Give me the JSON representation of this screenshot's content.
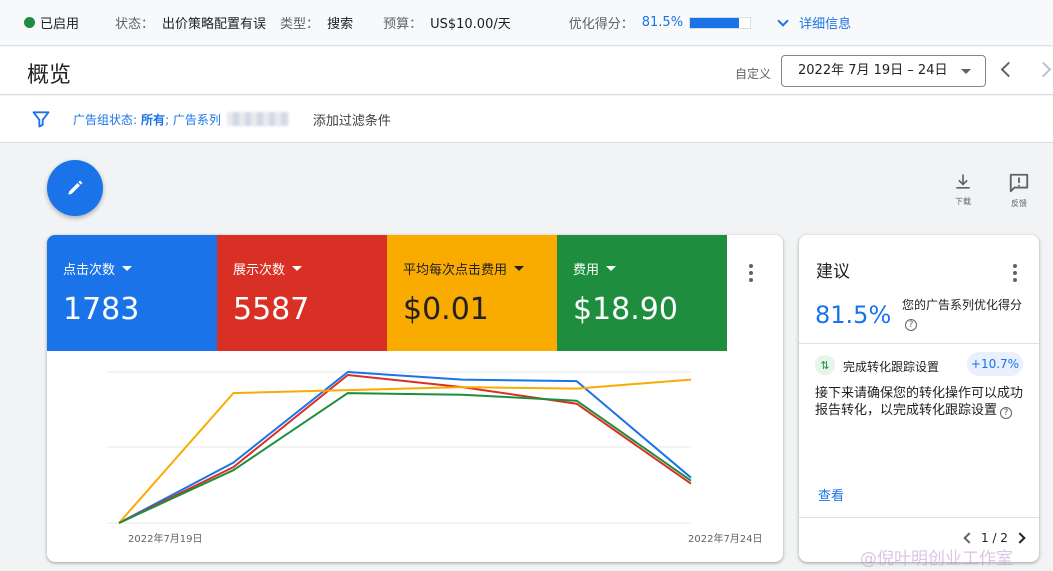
{
  "statusbar": {
    "enabled_label": "已启用",
    "status_label": "状态：",
    "status_value": "出价策略配置有误",
    "type_label": "类型：",
    "type_value": "搜索",
    "budget_label": "预算：",
    "budget_value": "US$10.00/天",
    "score_label": "优化得分：",
    "score_value": "81.5%",
    "score_fraction": 0.815,
    "details_label": "详细信息"
  },
  "header": {
    "title": "概览",
    "custom_label": "自定义",
    "date_range": "2022年 7月 19日 – 24日"
  },
  "filters": {
    "chip_prefix": "广告组状态:",
    "chip_value": "所有",
    "chip_suffix": "; 广告系列",
    "add_filter": "添加过滤条件"
  },
  "tools": {
    "download_label": "下载",
    "feedback_label": "反馈"
  },
  "metrics": [
    {
      "name": "点击次数",
      "value": "1783",
      "color": "#1a73e8"
    },
    {
      "name": "展示次数",
      "value": "5587",
      "color": "#d93025"
    },
    {
      "name": "平均每次点击费用",
      "value": "$0.01",
      "color": "#f9ab00"
    },
    {
      "name": "费用",
      "value": "$18.90",
      "color": "#1e8e3e"
    }
  ],
  "chart_data": {
    "type": "line",
    "x_start_label": "2022年7月19日",
    "x_end_label": "2022年7月24日",
    "grid": true,
    "series": [
      {
        "name": "点击次数",
        "color": "#1a73e8",
        "values": [
          0.0,
          0.4,
          1.0,
          0.95,
          0.94,
          0.3
        ]
      },
      {
        "name": "展示次数",
        "color": "#d93025",
        "values": [
          0.0,
          0.37,
          0.98,
          0.9,
          0.79,
          0.26
        ]
      },
      {
        "name": "平均每次点击费用",
        "color": "#f9ab00",
        "values": [
          0.0,
          0.86,
          0.88,
          0.9,
          0.89,
          0.95
        ]
      },
      {
        "name": "费用",
        "color": "#1e8e3e",
        "values": [
          0.0,
          0.35,
          0.86,
          0.85,
          0.81,
          0.28
        ]
      }
    ]
  },
  "suggestions": {
    "title": "建议",
    "score": "81.5%",
    "score_desc": "您的广告系列优化得分",
    "item_title": "完成转化跟踪设置",
    "uplift": "+10.7%",
    "body": "接下来请确保您的转化操作可以成功报告转化，以完成转化跟踪设置",
    "view_label": "查看",
    "pager": "1 / 2"
  },
  "watermark": "@倪叶明创业工作室"
}
